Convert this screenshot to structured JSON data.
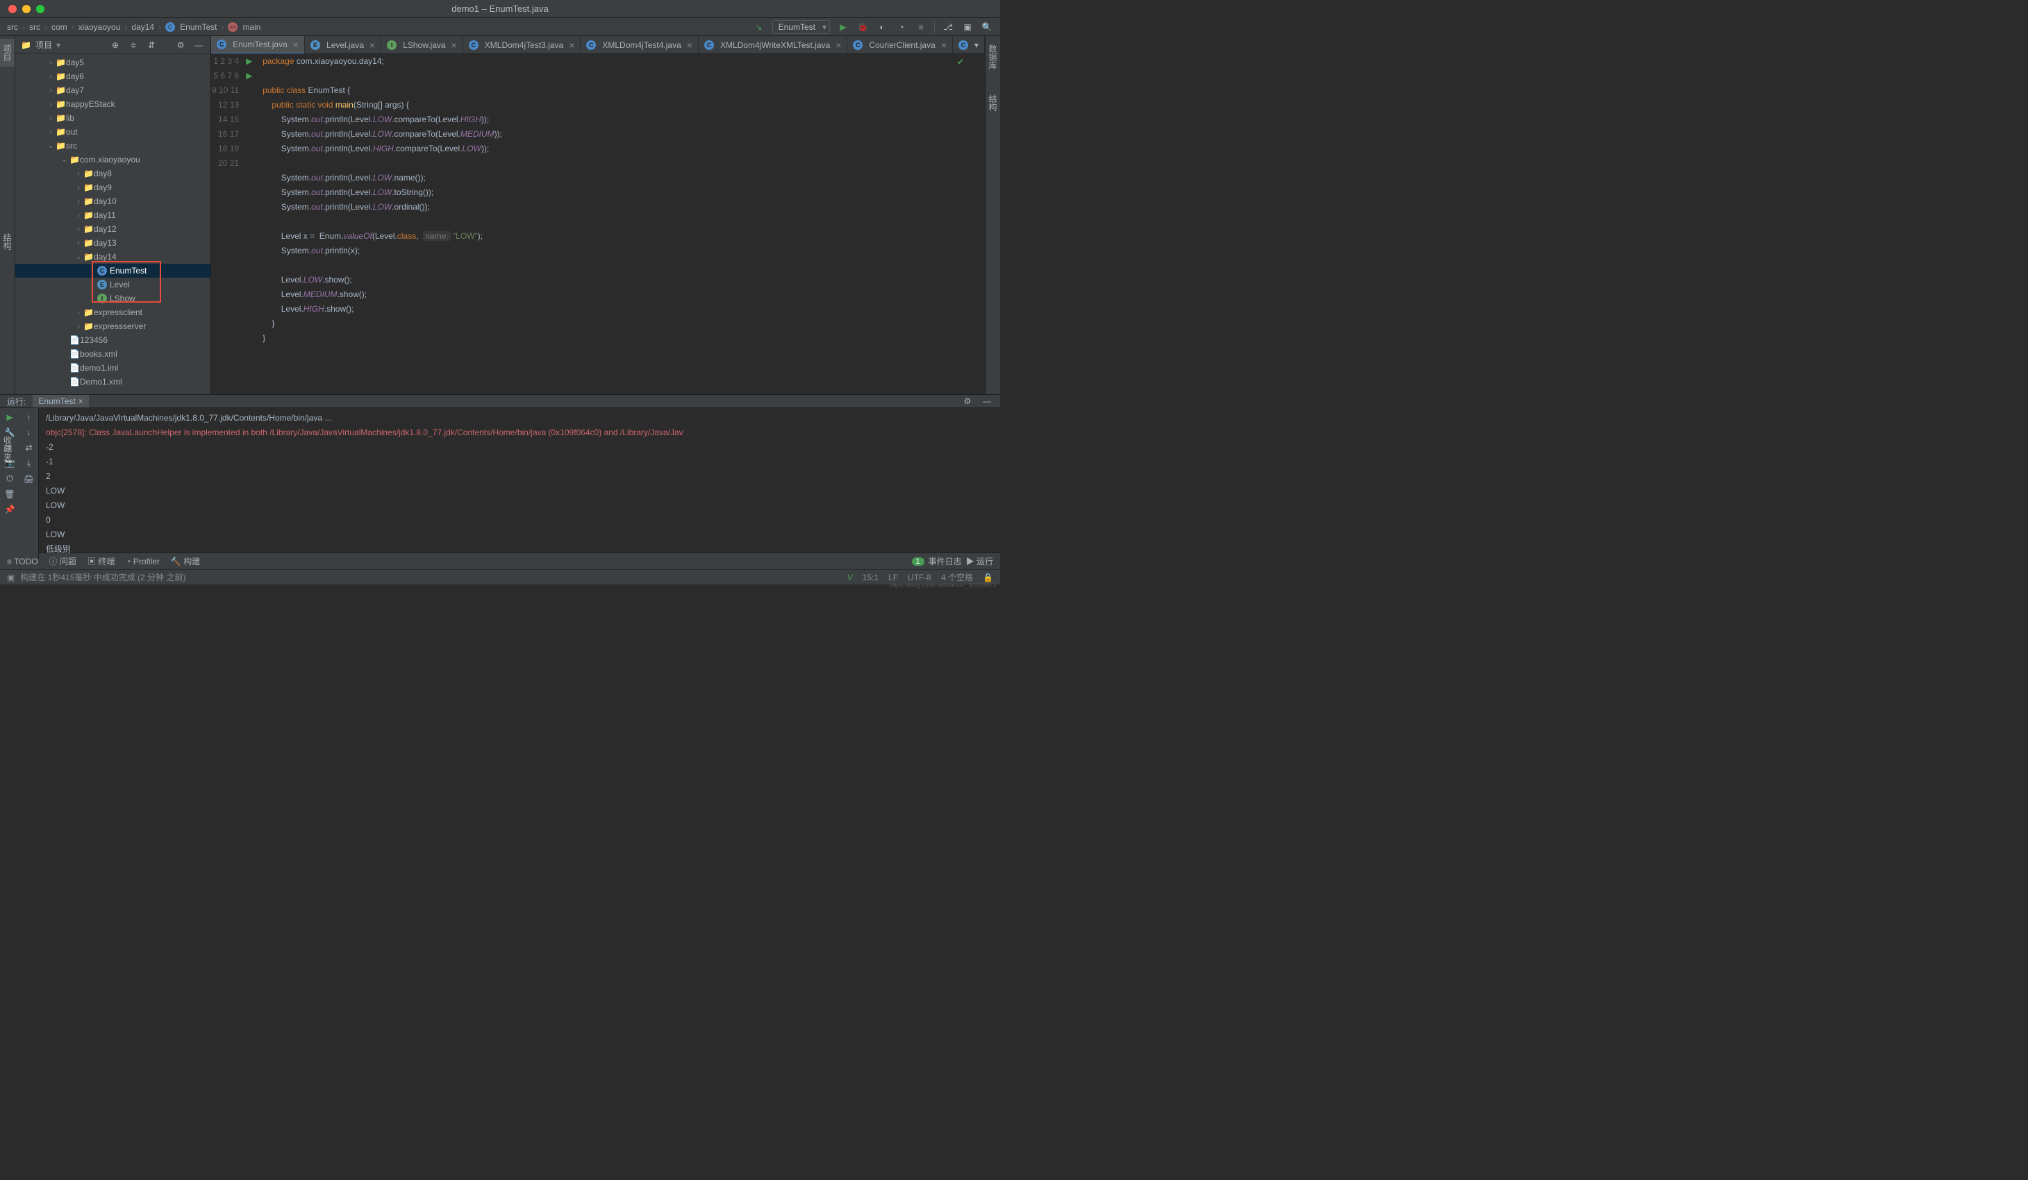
{
  "window_title": "demo1 – EnumTest.java",
  "breadcrumbs": [
    "src",
    "src",
    "com",
    "xiaoyaoyou",
    "day14",
    "EnumTest",
    "main"
  ],
  "run_config": "EnumTest",
  "project_label": "项目",
  "tree": {
    "day5": "day5",
    "day6": "day6",
    "day7": "day7",
    "happy": "happyEStack",
    "lib": "lib",
    "out": "out",
    "src": "src",
    "pkg": "com.xiaoyaoyou",
    "day8": "day8",
    "day9": "day9",
    "day10": "day10",
    "day11": "day11",
    "day12": "day12",
    "day13": "day13",
    "day14": "day14",
    "EnumTest": "EnumTest",
    "Level": "Level",
    "LShow": "LShow",
    "expressclient": "expressclient",
    "expressserver": "expressserver",
    "f123": "123456",
    "books": "books.xml",
    "demoiml": "demo1.iml",
    "demoxml": "Demo1.xml"
  },
  "tabs": [
    {
      "label": "EnumTest.java",
      "active": true
    },
    {
      "label": "Level.java"
    },
    {
      "label": "LShow.java"
    },
    {
      "label": "XMLDom4jTest3.java"
    },
    {
      "label": "XMLDom4jTest4.java"
    },
    {
      "label": "XMLDom4jWriteXMLTest.java"
    },
    {
      "label": "CourierClient.java"
    }
  ],
  "run_panel_label": "运行:",
  "run_tab": "EnumTest",
  "console": {
    "l1": "/Library/Java/JavaVirtualMachines/jdk1.8.0_77.jdk/Contents/Home/bin/java ...",
    "l2": "objc[2578]: Class JavaLaunchHelper is implemented in both /Library/Java/JavaVirtualMachines/jdk1.8.0_77.jdk/Contents/Home/bin/java (0x109f064c0) and /Library/Java/Jav",
    "l3": "-2",
    "l4": "-1",
    "l5": "2",
    "l6": "LOW",
    "l7": "LOW",
    "l8": "0",
    "l9": "LOW",
    "l10": "低级别"
  },
  "bottom": {
    "todo": "TODO",
    "problems": "问题",
    "terminal": "终端",
    "profiler": "Profiler",
    "build": "构建",
    "eventlog": "事件日志",
    "run": "运行"
  },
  "status": {
    "build": "构建在 1秒415毫秒 中成功完成 (2 分钟 之前)",
    "pos": "15:1",
    "lf": "LF",
    "enc": "UTF-8",
    "spaces": "4 个空格",
    "watermark": "https://blog.csdn.net/weixin_30510813"
  },
  "sidebar": {
    "project": "项目",
    "structure": "结构",
    "database": "数据库",
    "favorites": "收藏夹"
  },
  "eventcount": "1"
}
